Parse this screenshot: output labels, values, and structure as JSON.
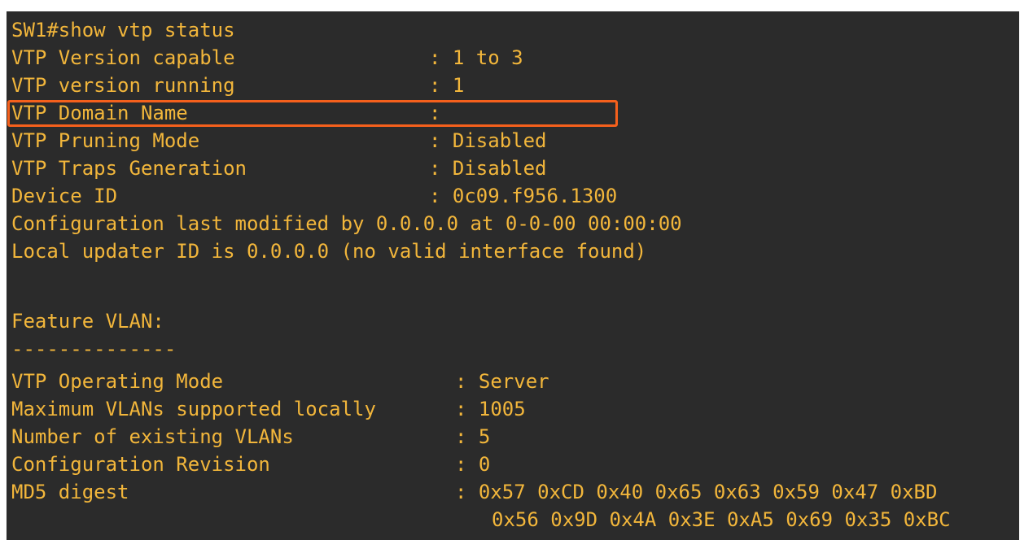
{
  "terminal": {
    "command": "SW1#show vtp status",
    "general": [
      {
        "label": "VTP Version capable",
        "sep": ": ",
        "value": "1 to 3"
      },
      {
        "label": "VTP version running",
        "sep": ": ",
        "value": "1"
      },
      {
        "label": "VTP Domain Name",
        "sep": ":",
        "value": ""
      },
      {
        "label": "VTP Pruning Mode",
        "sep": ": ",
        "value": "Disabled"
      },
      {
        "label": "VTP Traps Generation",
        "sep": ": ",
        "value": "Disabled"
      },
      {
        "label": "Device ID",
        "sep": ": ",
        "value": "0c09.f956.1300"
      }
    ],
    "config_modified": "Configuration last modified by 0.0.0.0 at 0-0-00 00:00:00",
    "local_updater": "Local updater ID is 0.0.0.0 (no valid interface found)",
    "feature_header": "Feature VLAN:",
    "feature_divider": "--------------",
    "feature": [
      {
        "label": "VTP Operating Mode",
        "sep": ": ",
        "value": "Server"
      },
      {
        "label": "Maximum VLANs supported locally",
        "sep": ": ",
        "value": "1005"
      },
      {
        "label": "Number of existing VLANs",
        "sep": ": ",
        "value": "5"
      },
      {
        "label": "Configuration Revision",
        "sep": ": ",
        "value": "0"
      },
      {
        "label": "MD5 digest",
        "sep": ": ",
        "value": "0x57 0xCD 0x40 0x65 0x63 0x59 0x47 0xBD"
      }
    ],
    "md5_continuation": "0x56 0x9D 0x4A 0x3E 0xA5 0x69 0x35 0xBC"
  },
  "colors": {
    "background": "#2b2b2b",
    "text": "#f2b63b",
    "highlight": "#f5601c"
  }
}
